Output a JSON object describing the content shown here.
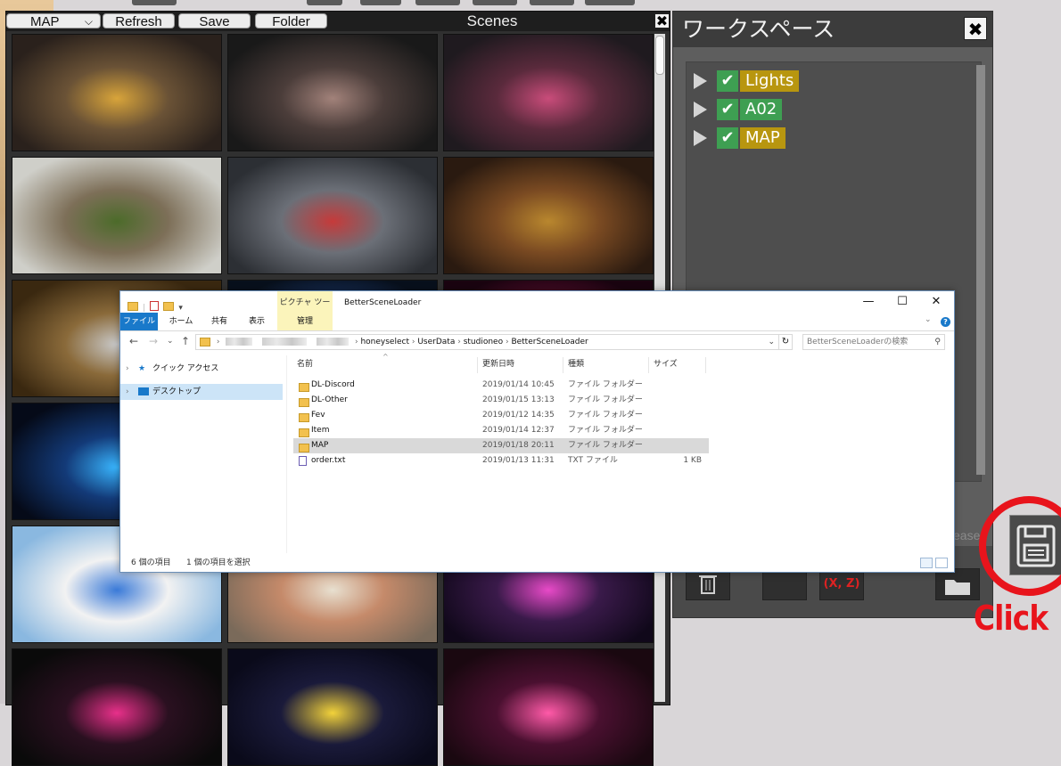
{
  "scenes": {
    "dropdown": "MAP",
    "buttons": {
      "refresh": "Refresh",
      "save": "Save",
      "folder": "Folder"
    },
    "title": "Scenes",
    "close": "✖",
    "thumbs": [
      {
        "c1": "#2a211c",
        "c2": "#6a5236",
        "accent": "#d8a43a"
      },
      {
        "c1": "#191919",
        "c2": "#4b3d3a",
        "accent": "#a2827a"
      },
      {
        "c1": "#1f1a1f",
        "c2": "#5a2a3c",
        "accent": "#c94c7a"
      },
      {
        "c1": "#cfcfc9",
        "c2": "#7d6f58",
        "accent": "#4c6b2a"
      },
      {
        "c1": "#2c2f34",
        "c2": "#6b6f77",
        "accent": "#c63a3a"
      },
      {
        "c1": "#2a1a10",
        "c2": "#7a4a22",
        "accent": "#b9872e"
      },
      {
        "c1": "#3a2810",
        "c2": "#8a6a3a",
        "accent": "#c9c9c9"
      },
      {
        "c1": "#08101c",
        "c2": "#1d3c74",
        "accent": "#3a8ae8"
      },
      {
        "c1": "#1a0410",
        "c2": "#6a1035",
        "accent": "#e83a8a"
      },
      {
        "c1": "#050a18",
        "c2": "#133a78",
        "accent": "#39b6ff"
      },
      {
        "c1": "#0c0c14",
        "c2": "#2a2a3a",
        "accent": "#5a5a7a"
      },
      {
        "c1": "#0a0a10",
        "c2": "#3a1030",
        "accent": "#c42a8a"
      },
      {
        "c1": "#8ab8e0",
        "c2": "#f2f2f2",
        "accent": "#3a7ad8"
      },
      {
        "c1": "#7a6a5a",
        "c2": "#c58a6a",
        "accent": "#e8e0d0"
      },
      {
        "c1": "#10081a",
        "c2": "#3a1a4a",
        "accent": "#e84ac8"
      },
      {
        "c1": "#0a0a0a",
        "c2": "#2a1020",
        "accent": "#e8308a"
      },
      {
        "c1": "#0a0a1a",
        "c2": "#1a1a3a",
        "accent": "#f2d23a"
      },
      {
        "c1": "#1a0810",
        "c2": "#4a1030",
        "accent": "#ff5aa8"
      }
    ]
  },
  "workspace": {
    "title": "ワークスペース",
    "close": "✖",
    "items": [
      {
        "label": "Lights",
        "bg": "#b8960f",
        "fg": "#ffffff"
      },
      {
        "label": "A02",
        "bg": "#3e9f52",
        "fg": "#ffffff"
      },
      {
        "label": "MAP",
        "bg": "#b8960f",
        "fg": "#ffffff"
      }
    ],
    "release_label": "ease",
    "tools": [
      "trash-icon",
      "blank-tool",
      "xz-tool",
      "folder-icon"
    ],
    "xz_label": "(X, Z)",
    "click_label": "Click"
  },
  "explorer": {
    "title": "BetterSceneLoader",
    "context_tab": "ピクチャ ツール",
    "ribbon_tabs": [
      "ファイル",
      "ホーム",
      "共有",
      "表示",
      "管理"
    ],
    "window_controls": {
      "minimize": "—",
      "maximize": "☐",
      "close": "✕"
    },
    "address": [
      "honeyselect",
      "UserData",
      "studioneo",
      "BetterSceneLoader"
    ],
    "search_placeholder": "BetterSceneLoaderの検索",
    "nav": [
      {
        "label": "クイック アクセス",
        "icon": "star-icon"
      },
      {
        "label": "デスクトップ",
        "icon": "desktop-icon",
        "selected": true
      }
    ],
    "columns": {
      "name": "名前",
      "date": "更新日時",
      "type": "種類",
      "size": "サイズ"
    },
    "files": [
      {
        "name": "DL-Discord",
        "date": "2019/01/14 10:45",
        "type": "ファイル フォルダー",
        "size": "",
        "kind": "folder"
      },
      {
        "name": "DL-Other",
        "date": "2019/01/15 13:13",
        "type": "ファイル フォルダー",
        "size": "",
        "kind": "folder"
      },
      {
        "name": "Fev",
        "date": "2019/01/12 14:35",
        "type": "ファイル フォルダー",
        "size": "",
        "kind": "folder"
      },
      {
        "name": "Item",
        "date": "2019/01/14 12:37",
        "type": "ファイル フォルダー",
        "size": "",
        "kind": "folder"
      },
      {
        "name": "MAP",
        "date": "2019/01/18 20:11",
        "type": "ファイル フォルダー",
        "size": "",
        "kind": "folder",
        "selected": true
      },
      {
        "name": "order.txt",
        "date": "2019/01/13 11:31",
        "type": "TXT ファイル",
        "size": "1 KB",
        "kind": "txt"
      }
    ],
    "status_count": "6 個の項目",
    "status_selected": "1 個の項目を選択"
  }
}
